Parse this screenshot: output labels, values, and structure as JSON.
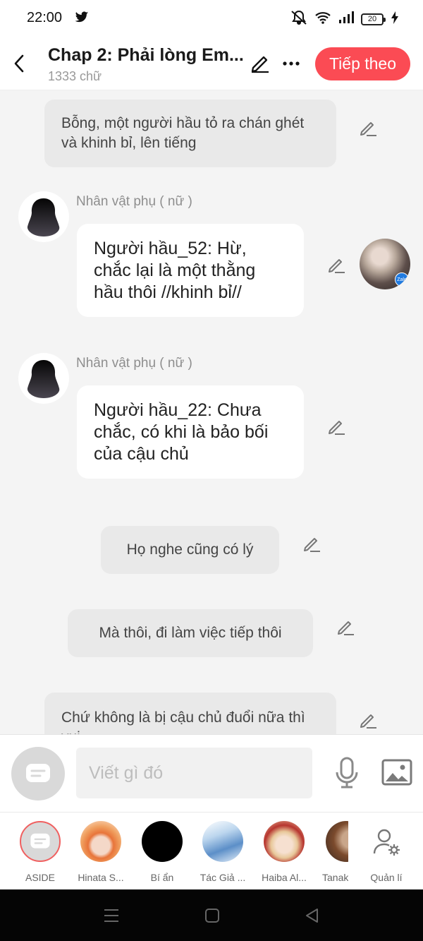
{
  "status_bar": {
    "time": "22:00",
    "battery": "20"
  },
  "header": {
    "title": "Chap 2: Phải lòng Em...",
    "word_count": "1333 chữ",
    "next_label": "Tiếp theo",
    "accent_color": "#fb4b54"
  },
  "messages": [
    {
      "kind": "narration",
      "text": "Bỗng, một người hầu tỏ ra chán ghét và khinh bỉ, lên tiếng"
    },
    {
      "kind": "dialogue",
      "speaker": "Nhân vật phụ ( nữ )",
      "text": "Người hầu_52: Hừ, chắc lại là một thằng hầu thôi //khinh bỉ//"
    },
    {
      "kind": "dialogue",
      "speaker": "Nhân vật phụ ( nữ )",
      "text": "Người hầu_22: Chưa chắc, có khi là bảo bối của cậu chủ"
    },
    {
      "kind": "narration",
      "text": "Họ nghe cũng có lý"
    },
    {
      "kind": "narration",
      "text": "Mà thôi, đi làm việc tiếp thôi"
    },
    {
      "kind": "narration",
      "text": "Chứ không là bị cậu chủ đuổi nữa thì vui"
    }
  ],
  "floating_avatar": {
    "badge": "Zalo"
  },
  "input": {
    "placeholder": "Viết gì đó"
  },
  "characters": [
    {
      "label": "ASIDE"
    },
    {
      "label": "Hinata S..."
    },
    {
      "label": "Bí ẩn"
    },
    {
      "label": "Tác Giả ..."
    },
    {
      "label": "Haiba Al..."
    },
    {
      "label": "Tanak"
    },
    {
      "label": "Quản lí"
    }
  ]
}
